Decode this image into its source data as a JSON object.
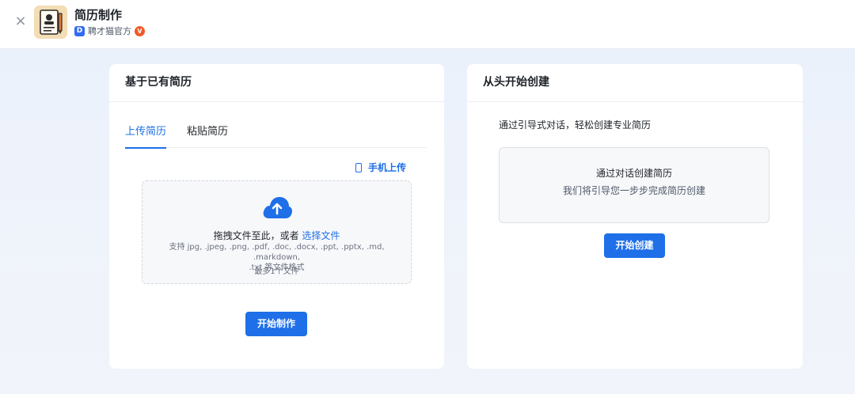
{
  "header": {
    "app_title": "简历制作",
    "publisher": "聘才猫官方",
    "close_symbol": "×",
    "publisher_logo_glyph": "D",
    "verified_glyph": "V"
  },
  "left_card": {
    "title": "基于已有简历",
    "tabs": [
      {
        "label": "上传简历",
        "active": true
      },
      {
        "label": "粘贴简历",
        "active": false
      }
    ],
    "mobile_upload_label": "手机上传",
    "dropzone": {
      "main_text": "拖拽文件至此，或者",
      "link_text": "选择文件",
      "support_line1": "支持 jpg, .jpeg, .png, .pdf, .doc, .docx, .ppt, .pptx, .md, .markdown,",
      "support_line2": ".txt 等文件格式",
      "limit": "最多1个文件"
    },
    "start_button": "开始制作"
  },
  "right_card": {
    "title": "从头开始创建",
    "description": "通过引导式对话，轻松创建专业简历",
    "dialog_title": "通过对话创建简历",
    "dialog_subtitle": "我们将引导您一步步完成简历创建",
    "create_button": "开始创建"
  },
  "colors": {
    "accent": "#1e6fe8",
    "verified": "#f05a28",
    "publisher_logo": "#2f6bf3"
  }
}
